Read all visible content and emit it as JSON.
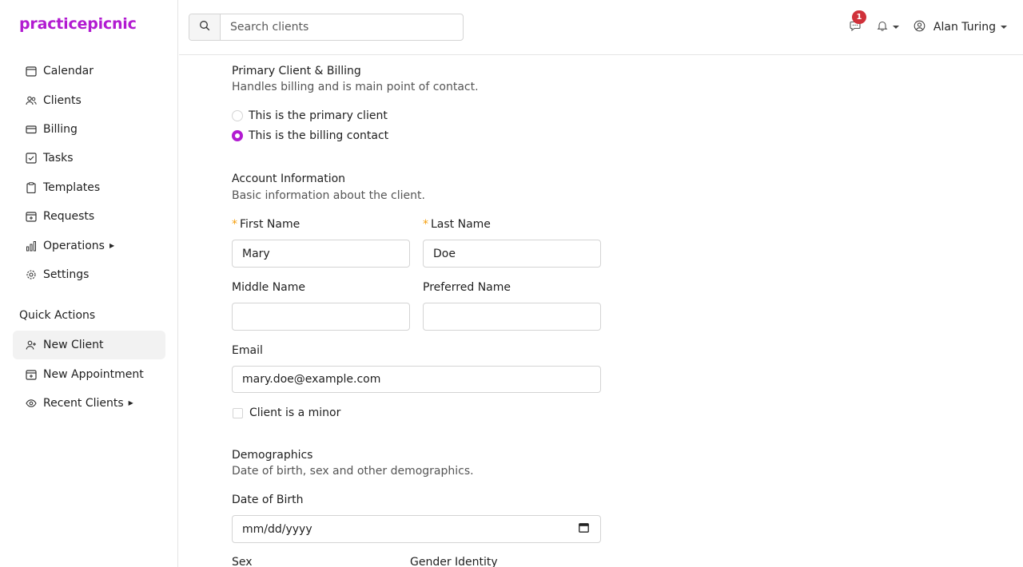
{
  "brand": {
    "name": "practicepicnic",
    "color": "#b21bd1"
  },
  "sidebar": {
    "items": [
      {
        "label": "Calendar",
        "icon": "calendar-icon"
      },
      {
        "label": "Clients",
        "icon": "users-icon"
      },
      {
        "label": "Billing",
        "icon": "credit-card-icon"
      },
      {
        "label": "Tasks",
        "icon": "check-square-icon"
      },
      {
        "label": "Templates",
        "icon": "clipboard-icon"
      },
      {
        "label": "Requests",
        "icon": "calendar-plus-icon"
      },
      {
        "label": "Operations",
        "icon": "bar-chart-icon"
      },
      {
        "label": "Settings",
        "icon": "gear-icon"
      }
    ],
    "quick_actions_title": "Quick Actions",
    "quick_actions": [
      {
        "label": "New Client",
        "icon": "user-plus-icon"
      },
      {
        "label": "New Appointment",
        "icon": "calendar-plus-icon"
      },
      {
        "label": "Recent Clients",
        "icon": "eye-icon"
      }
    ]
  },
  "header": {
    "search_placeholder": "Search clients",
    "messages_count": "1",
    "user_name": "Alan Turing"
  },
  "form": {
    "primary": {
      "title": "Primary Client & Billing",
      "subtitle": "Handles billing and is main point of contact.",
      "option_primary": "This is the primary client",
      "option_billing": "This is the billing contact",
      "selected": "billing"
    },
    "account": {
      "title": "Account Information",
      "subtitle": "Basic information about the client.",
      "first_name_label": "First Name",
      "first_name_value": "Mary",
      "last_name_label": "Last Name",
      "last_name_value": "Doe",
      "middle_name_label": "Middle Name",
      "middle_name_value": "",
      "preferred_name_label": "Preferred Name",
      "preferred_name_value": "",
      "email_label": "Email",
      "email_value": "mary.doe@example.com",
      "minor_label": "Client is a minor",
      "required_mark": "*"
    },
    "demographics": {
      "title": "Demographics",
      "subtitle": "Date of birth, sex and other demographics.",
      "dob_label": "Date of Birth",
      "dob_placeholder": "mm/dd/yyyy",
      "sex_label": "Sex",
      "gender_label": "Gender Identity"
    }
  }
}
